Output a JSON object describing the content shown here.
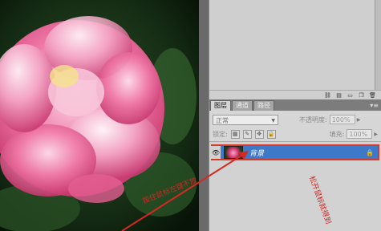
{
  "panel": {
    "tabs": [
      {
        "label": "图层",
        "active": true
      },
      {
        "label": "通道",
        "active": false
      },
      {
        "label": "路径",
        "active": false
      }
    ],
    "blend_mode": "正常",
    "opacity_label": "不透明度:",
    "opacity_value": "100%",
    "lock_label": "锁定:",
    "fill_label": "填充:",
    "fill_value": "100%",
    "layers": [
      {
        "name": "背景",
        "visible": true,
        "locked": true,
        "selected": true
      }
    ]
  },
  "annotations": {
    "left": "按住鼠标左键不放",
    "right": "松开鼠标就得到"
  },
  "colors": {
    "selection": "#3e78c8",
    "highlight_border": "#d83a2a",
    "annotation": "#c62a25"
  },
  "icons": {
    "upper_footer": [
      "link-icon",
      "new-doc-icon",
      "folder-icon",
      "new-layer-icon",
      "trash-icon"
    ]
  }
}
